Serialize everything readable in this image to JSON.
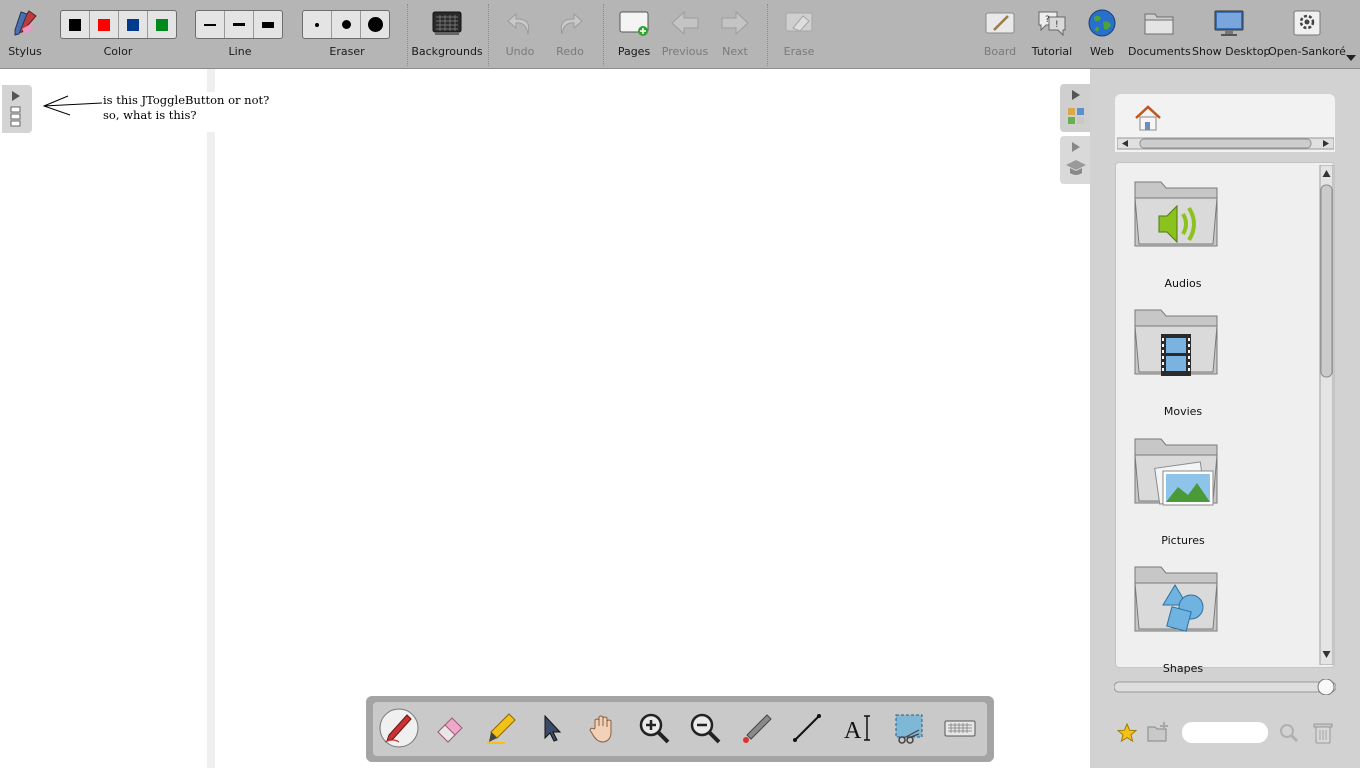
{
  "toolbar": {
    "stylus_label": "Stylus",
    "color_label": "Color",
    "line_label": "Line",
    "eraser_label": "Eraser",
    "backgrounds_label": "Backgrounds",
    "undo_label": "Undo",
    "redo_label": "Redo",
    "pages_label": "Pages",
    "previous_label": "Previous",
    "next_label": "Next",
    "erase_label": "Erase",
    "board_label": "Board",
    "tutorial_label": "Tutorial",
    "web_label": "Web",
    "documents_label": "Documents",
    "show_desktop_label": "Show Desktop",
    "open_sankore_label": "Open-Sankoré",
    "colors": [
      "#000000",
      "#ff0000",
      "#003b8e",
      "#008a1e"
    ]
  },
  "board": {
    "note_line1": "is this JToggleButton or not?",
    "note_line2": "so, what is this?"
  },
  "library": {
    "items": [
      {
        "label": "Audios",
        "icon": "speaker-icon"
      },
      {
        "label": "Movies",
        "icon": "film-icon"
      },
      {
        "label": "Pictures",
        "icon": "picture-icon"
      },
      {
        "label": "Shapes",
        "icon": "shapes-icon"
      }
    ],
    "search_placeholder": ""
  },
  "palette": {
    "tools": [
      "pen-tool",
      "eraser-tool",
      "marker-tool",
      "selector-tool",
      "hand-tool",
      "zoom-in-tool",
      "zoom-out-tool",
      "laser-pointer-tool",
      "line-tool",
      "text-tool",
      "capture-tool",
      "keyboard-tool"
    ],
    "active_tool": "pen-tool"
  },
  "colors": {
    "toolbar_bg": "#b5b5b5",
    "panel_bg": "#d2d2d2",
    "disabled_text": "#7a7a7a"
  }
}
